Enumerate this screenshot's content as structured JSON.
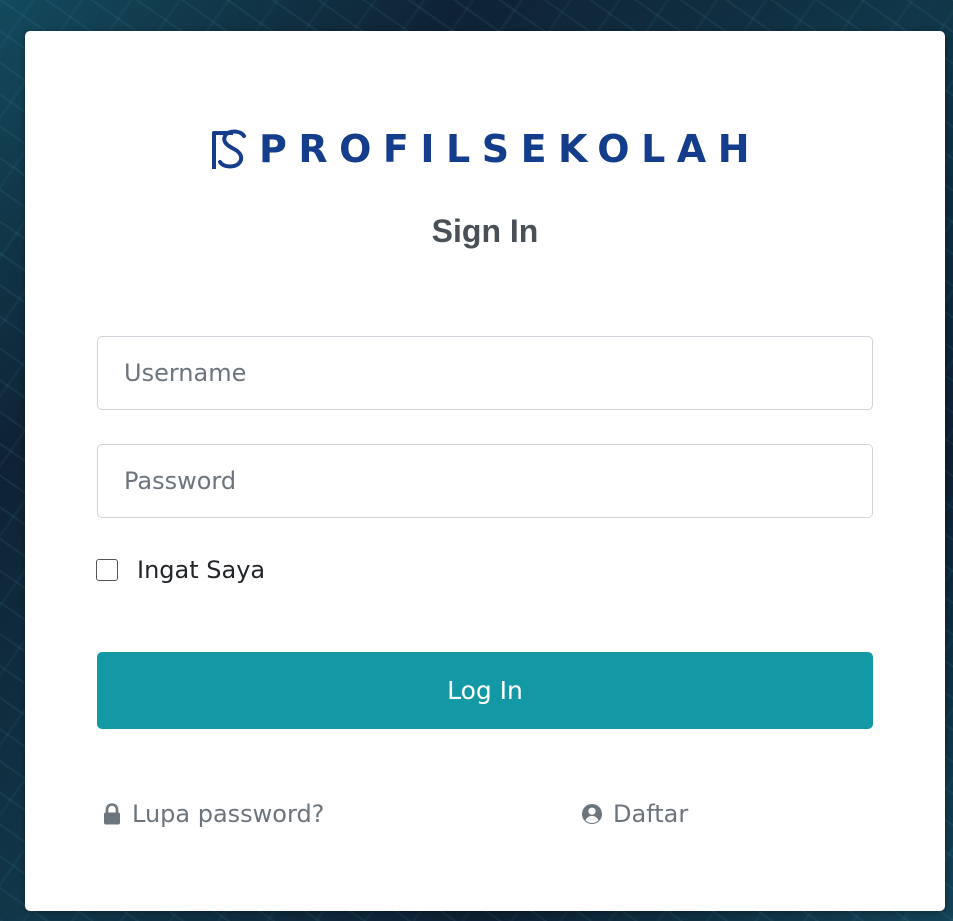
{
  "brand": {
    "name": "PROFILSEKOLAH",
    "logo_icon": "ps-logo-icon",
    "color": "#143e8c"
  },
  "form": {
    "title": "Sign In",
    "username": {
      "placeholder": "Username",
      "value": ""
    },
    "password": {
      "placeholder": "Password",
      "value": ""
    },
    "remember": {
      "label": "Ingat Saya",
      "checked": false
    },
    "submit_label": "Log In",
    "accent_color": "#1399a6"
  },
  "links": {
    "forgot": {
      "label": "Lupa password?",
      "icon": "lock-icon"
    },
    "register": {
      "label": "Daftar",
      "icon": "user-circle-icon"
    }
  }
}
